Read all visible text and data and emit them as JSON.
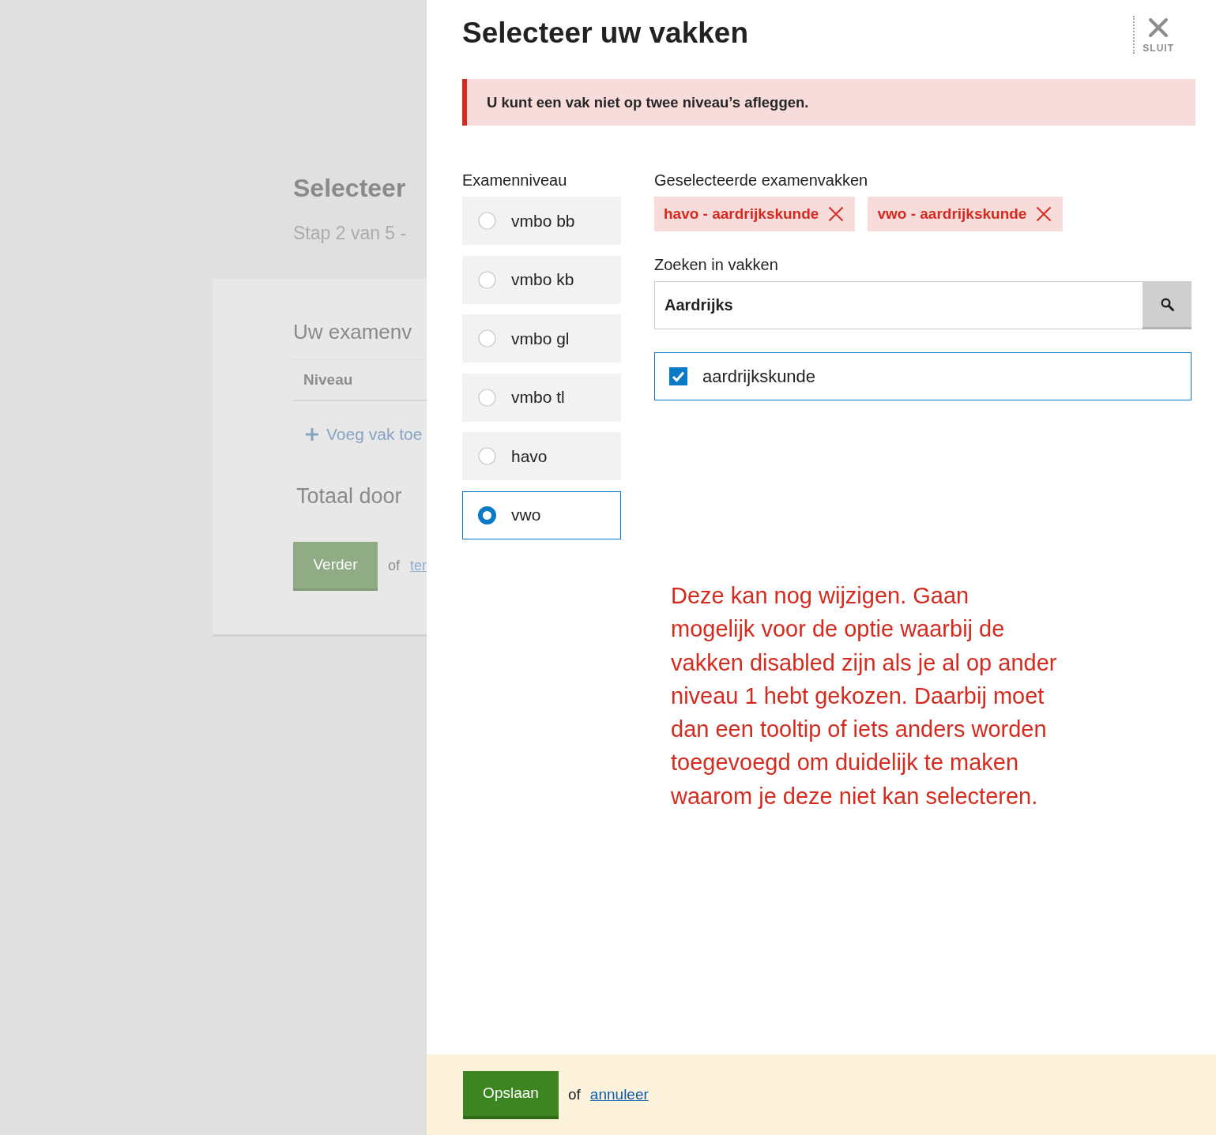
{
  "background_page": {
    "title": "Selecteer",
    "subtitle": "Stap 2 van 5 -",
    "card": {
      "heading": "Uw examenv",
      "table_header": "Niveau",
      "add_link": "Voeg vak toe",
      "total": "Totaal door",
      "next_button": "Verder",
      "back_text": "of",
      "back_link": "ter"
    }
  },
  "dialog": {
    "title": "Selecteer uw vakken",
    "close_label": "SLUIT",
    "error": "U kunt een vak niet op twee niveau’s afleggen.",
    "levels": {
      "label": "Examenniveau",
      "options": [
        {
          "label": "vmbo bb",
          "selected": false
        },
        {
          "label": "vmbo kb",
          "selected": false
        },
        {
          "label": "vmbo gl",
          "selected": false
        },
        {
          "label": "vmbo tl",
          "selected": false
        },
        {
          "label": "havo",
          "selected": false
        },
        {
          "label": "vwo",
          "selected": true
        }
      ]
    },
    "selected_subjects": {
      "label": "Geselecteerde examenvakken",
      "tags": [
        {
          "label": "havo - aardrijkskunde"
        },
        {
          "label": "vwo - aardrijkskunde"
        }
      ]
    },
    "search": {
      "label": "Zoeken in vakken",
      "value": "Aardrijks"
    },
    "results": [
      {
        "label": "aardrijkskunde",
        "checked": true
      }
    ],
    "note": "Deze kan nog wijzigen. Gaan mogelijk voor de optie waarbij de vakken disabled zijn als je al op ander niveau 1 hebt gekozen. Daarbij moet dan een tooltip of iets anders worden toegevoegd om duidelijk te maken waarom je deze niet kan selecteren.",
    "footer": {
      "save_button": "Opslaan",
      "or_text": "of",
      "cancel_link": "annuleer"
    }
  }
}
